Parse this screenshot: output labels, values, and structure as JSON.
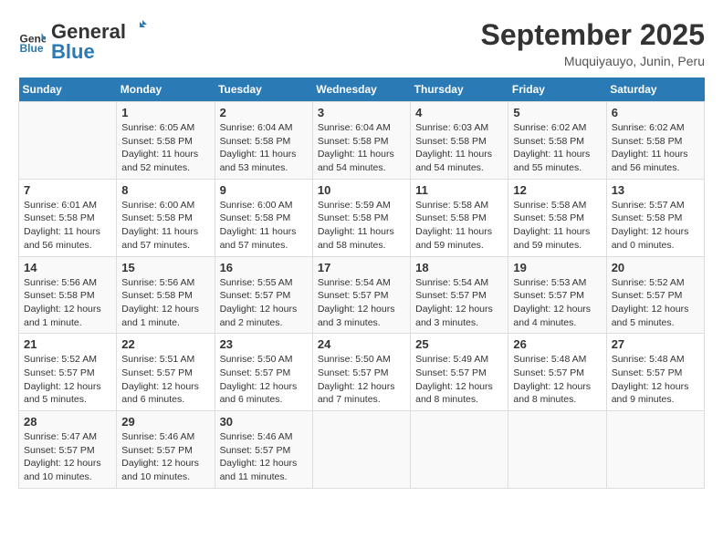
{
  "header": {
    "logo_general": "General",
    "logo_blue": "Blue",
    "month": "September 2025",
    "location": "Muquiyauyo, Junin, Peru"
  },
  "calendar": {
    "days_of_week": [
      "Sunday",
      "Monday",
      "Tuesday",
      "Wednesday",
      "Thursday",
      "Friday",
      "Saturday"
    ],
    "weeks": [
      [
        {
          "day": "",
          "info": ""
        },
        {
          "day": "1",
          "info": "Sunrise: 6:05 AM\nSunset: 5:58 PM\nDaylight: 11 hours\nand 52 minutes."
        },
        {
          "day": "2",
          "info": "Sunrise: 6:04 AM\nSunset: 5:58 PM\nDaylight: 11 hours\nand 53 minutes."
        },
        {
          "day": "3",
          "info": "Sunrise: 6:04 AM\nSunset: 5:58 PM\nDaylight: 11 hours\nand 54 minutes."
        },
        {
          "day": "4",
          "info": "Sunrise: 6:03 AM\nSunset: 5:58 PM\nDaylight: 11 hours\nand 54 minutes."
        },
        {
          "day": "5",
          "info": "Sunrise: 6:02 AM\nSunset: 5:58 PM\nDaylight: 11 hours\nand 55 minutes."
        },
        {
          "day": "6",
          "info": "Sunrise: 6:02 AM\nSunset: 5:58 PM\nDaylight: 11 hours\nand 56 minutes."
        }
      ],
      [
        {
          "day": "7",
          "info": "Sunrise: 6:01 AM\nSunset: 5:58 PM\nDaylight: 11 hours\nand 56 minutes."
        },
        {
          "day": "8",
          "info": "Sunrise: 6:00 AM\nSunset: 5:58 PM\nDaylight: 11 hours\nand 57 minutes."
        },
        {
          "day": "9",
          "info": "Sunrise: 6:00 AM\nSunset: 5:58 PM\nDaylight: 11 hours\nand 57 minutes."
        },
        {
          "day": "10",
          "info": "Sunrise: 5:59 AM\nSunset: 5:58 PM\nDaylight: 11 hours\nand 58 minutes."
        },
        {
          "day": "11",
          "info": "Sunrise: 5:58 AM\nSunset: 5:58 PM\nDaylight: 11 hours\nand 59 minutes."
        },
        {
          "day": "12",
          "info": "Sunrise: 5:58 AM\nSunset: 5:58 PM\nDaylight: 11 hours\nand 59 minutes."
        },
        {
          "day": "13",
          "info": "Sunrise: 5:57 AM\nSunset: 5:58 PM\nDaylight: 12 hours\nand 0 minutes."
        }
      ],
      [
        {
          "day": "14",
          "info": "Sunrise: 5:56 AM\nSunset: 5:58 PM\nDaylight: 12 hours\nand 1 minute."
        },
        {
          "day": "15",
          "info": "Sunrise: 5:56 AM\nSunset: 5:58 PM\nDaylight: 12 hours\nand 1 minute."
        },
        {
          "day": "16",
          "info": "Sunrise: 5:55 AM\nSunset: 5:57 PM\nDaylight: 12 hours\nand 2 minutes."
        },
        {
          "day": "17",
          "info": "Sunrise: 5:54 AM\nSunset: 5:57 PM\nDaylight: 12 hours\nand 3 minutes."
        },
        {
          "day": "18",
          "info": "Sunrise: 5:54 AM\nSunset: 5:57 PM\nDaylight: 12 hours\nand 3 minutes."
        },
        {
          "day": "19",
          "info": "Sunrise: 5:53 AM\nSunset: 5:57 PM\nDaylight: 12 hours\nand 4 minutes."
        },
        {
          "day": "20",
          "info": "Sunrise: 5:52 AM\nSunset: 5:57 PM\nDaylight: 12 hours\nand 5 minutes."
        }
      ],
      [
        {
          "day": "21",
          "info": "Sunrise: 5:52 AM\nSunset: 5:57 PM\nDaylight: 12 hours\nand 5 minutes."
        },
        {
          "day": "22",
          "info": "Sunrise: 5:51 AM\nSunset: 5:57 PM\nDaylight: 12 hours\nand 6 minutes."
        },
        {
          "day": "23",
          "info": "Sunrise: 5:50 AM\nSunset: 5:57 PM\nDaylight: 12 hours\nand 6 minutes."
        },
        {
          "day": "24",
          "info": "Sunrise: 5:50 AM\nSunset: 5:57 PM\nDaylight: 12 hours\nand 7 minutes."
        },
        {
          "day": "25",
          "info": "Sunrise: 5:49 AM\nSunset: 5:57 PM\nDaylight: 12 hours\nand 8 minutes."
        },
        {
          "day": "26",
          "info": "Sunrise: 5:48 AM\nSunset: 5:57 PM\nDaylight: 12 hours\nand 8 minutes."
        },
        {
          "day": "27",
          "info": "Sunrise: 5:48 AM\nSunset: 5:57 PM\nDaylight: 12 hours\nand 9 minutes."
        }
      ],
      [
        {
          "day": "28",
          "info": "Sunrise: 5:47 AM\nSunset: 5:57 PM\nDaylight: 12 hours\nand 10 minutes."
        },
        {
          "day": "29",
          "info": "Sunrise: 5:46 AM\nSunset: 5:57 PM\nDaylight: 12 hours\nand 10 minutes."
        },
        {
          "day": "30",
          "info": "Sunrise: 5:46 AM\nSunset: 5:57 PM\nDaylight: 12 hours\nand 11 minutes."
        },
        {
          "day": "",
          "info": ""
        },
        {
          "day": "",
          "info": ""
        },
        {
          "day": "",
          "info": ""
        },
        {
          "day": "",
          "info": ""
        }
      ]
    ]
  }
}
